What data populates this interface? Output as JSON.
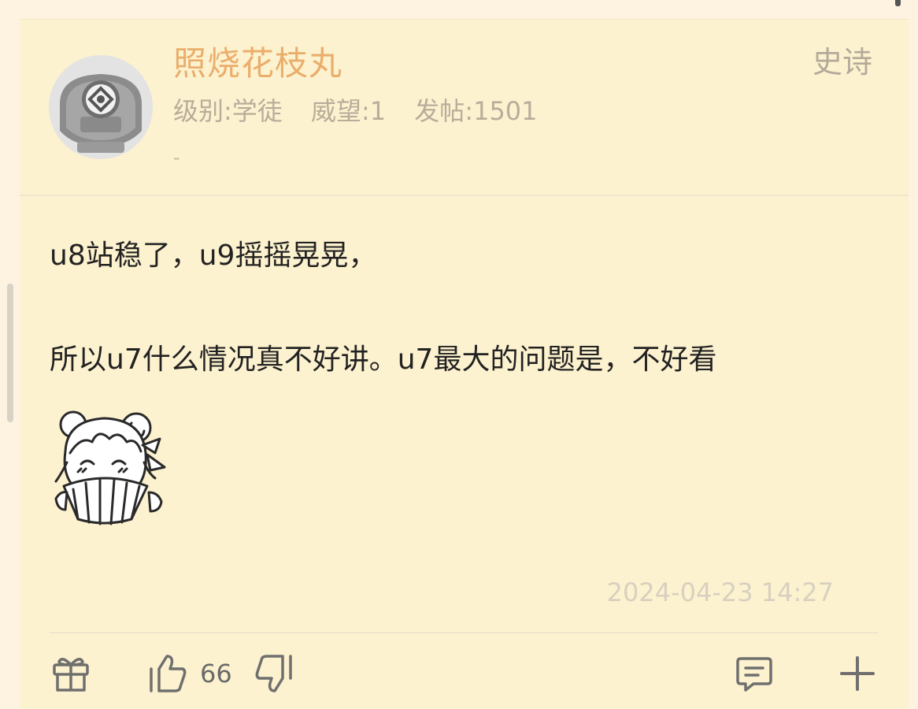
{
  "post": {
    "author": {
      "name": "照烧花枝丸",
      "level": "级别:学徒",
      "prestige": "威望:1",
      "posts": "发帖:1501",
      "signature": "-"
    },
    "tag": "史诗",
    "content": {
      "line1": "u8站稳了，u9摇摇晃晃，",
      "line2": "所以u7什么情况真不好讲。u7最大的问题是，不好看"
    },
    "timestamp": "2024-04-23 14:27"
  },
  "actions": {
    "like_count": "66",
    "icons": [
      "gift-icon",
      "thumbs-up-icon",
      "thumbs-down-icon",
      "comment-icon",
      "plus-icon"
    ]
  },
  "colors": {
    "card_bg": "#fdf2cf",
    "username": "#eaae6c",
    "meta_text": "#b7ad9a"
  }
}
